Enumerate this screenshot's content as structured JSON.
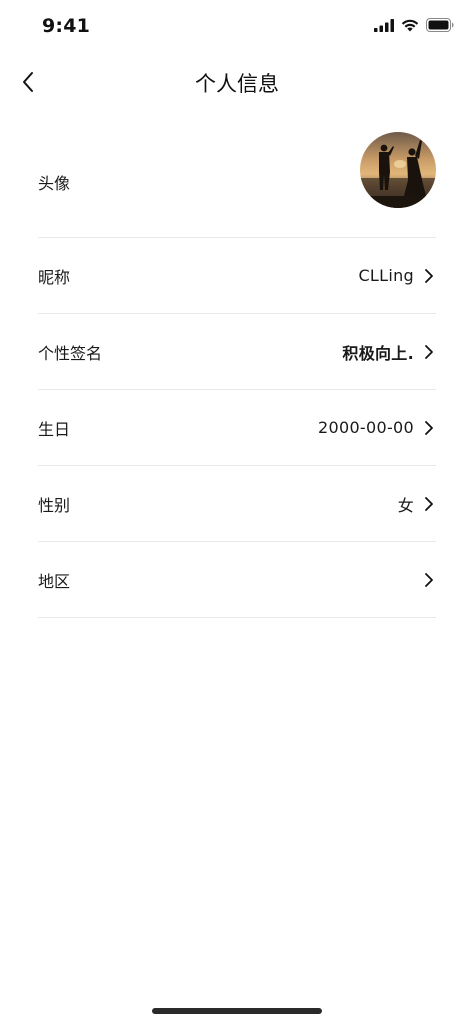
{
  "status_bar": {
    "time": "9:41",
    "icons": [
      "signal-icon",
      "wifi-icon",
      "battery-icon"
    ]
  },
  "nav": {
    "title": "个人信息",
    "back_icon": "chevron-left-icon"
  },
  "profile": {
    "avatar_label": "头像",
    "rows": [
      {
        "label": "昵称",
        "value": "CLLing"
      },
      {
        "label": "个性签名",
        "value": "积极向上."
      },
      {
        "label": "生日",
        "value": "2000-00-00"
      },
      {
        "label": "性别",
        "value": "女"
      },
      {
        "label": "地区",
        "value": ""
      }
    ]
  },
  "colors": {
    "background": "#ffffff",
    "text": "#1a1a1a",
    "divider": "#e8e8e8",
    "home_indicator": "#2a2a2a"
  }
}
